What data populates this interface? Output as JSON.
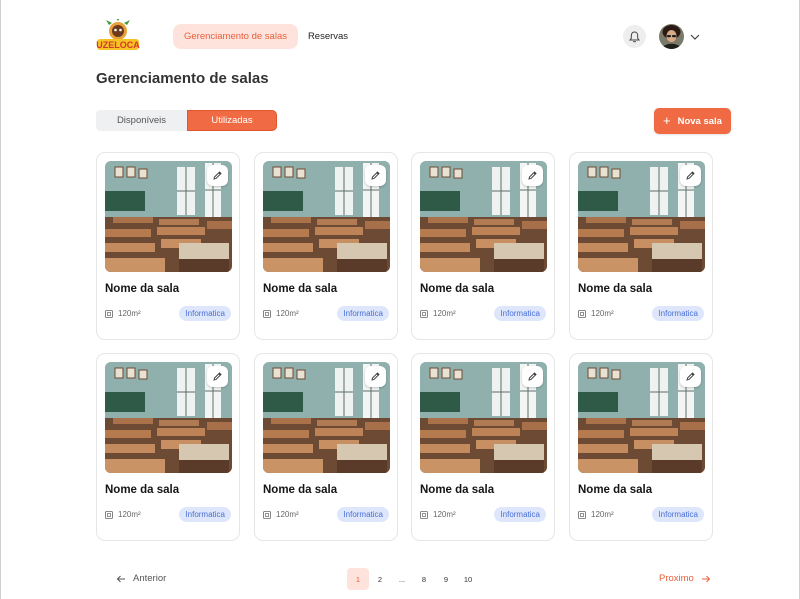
{
  "header": {
    "logo_text": "UZELOCA",
    "nav": [
      {
        "label": "Gerenciamento de salas",
        "active": true
      },
      {
        "label": "Reservas",
        "active": false
      }
    ],
    "notification_icon": "bell-icon",
    "avatar_icon": "user-avatar",
    "menu_icon": "chevron-down-icon"
  },
  "page": {
    "title": "Gerenciamento de salas"
  },
  "tabs": [
    {
      "label": "Disponíveis",
      "active": false
    },
    {
      "label": "Utilizadas",
      "active": true
    }
  ],
  "actions": {
    "new_room_label": "Nova sala",
    "new_room_icon": "plus-icon"
  },
  "rooms": [
    {
      "name": "Nome da sala",
      "area": "120m²",
      "tag": "Informatica"
    },
    {
      "name": "Nome da sala",
      "area": "120m²",
      "tag": "Informatica"
    },
    {
      "name": "Nome da sala",
      "area": "120m²",
      "tag": "Informatica"
    },
    {
      "name": "Nome da sala",
      "area": "120m²",
      "tag": "Informatica"
    },
    {
      "name": "Nome da sala",
      "area": "120m²",
      "tag": "Informatica"
    },
    {
      "name": "Nome da sala",
      "area": "120m²",
      "tag": "Informatica"
    },
    {
      "name": "Nome da sala",
      "area": "120m²",
      "tag": "Informatica"
    },
    {
      "name": "Nome da sala",
      "area": "120m²",
      "tag": "Informatica"
    }
  ],
  "pagination": {
    "prev_label": "Anterior",
    "next_label": "Proximo",
    "pages": [
      "1",
      "2",
      "...",
      "8",
      "9",
      "10"
    ],
    "current": "1"
  },
  "colors": {
    "accent": "#f06a43",
    "accent_soft": "#fde3dc",
    "tag_bg": "#dde6fb",
    "tag_text": "#4a6fd8"
  }
}
